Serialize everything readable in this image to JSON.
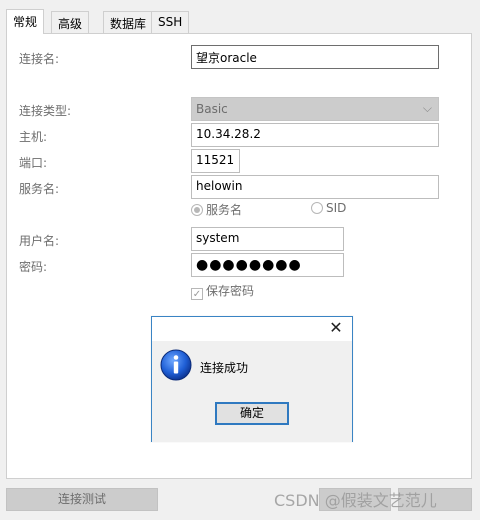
{
  "tabs": [
    "常规",
    "高级",
    "数据库",
    "SSH"
  ],
  "form": {
    "connection_name_label": "连接名:",
    "connection_name_value": "望京oracle",
    "connection_type_label": "连接类型:",
    "connection_type_value": "Basic",
    "host_label": "主机:",
    "host_value": "10.34.28.2",
    "port_label": "端口:",
    "port_value": "11521",
    "service_label": "服务名:",
    "service_value": "helowin",
    "radio_service_name": "服务名",
    "radio_sid": "SID",
    "username_label": "用户名:",
    "username_value": "system",
    "password_label": "密码:",
    "password_value": "●●●●●●●●",
    "save_password_label": "保存密码"
  },
  "dialog": {
    "message": "连接成功",
    "ok_label": "确定"
  },
  "footer": {
    "test_connection_label": "连接测试",
    "watermark": "CSDN @假装文艺范儿"
  }
}
